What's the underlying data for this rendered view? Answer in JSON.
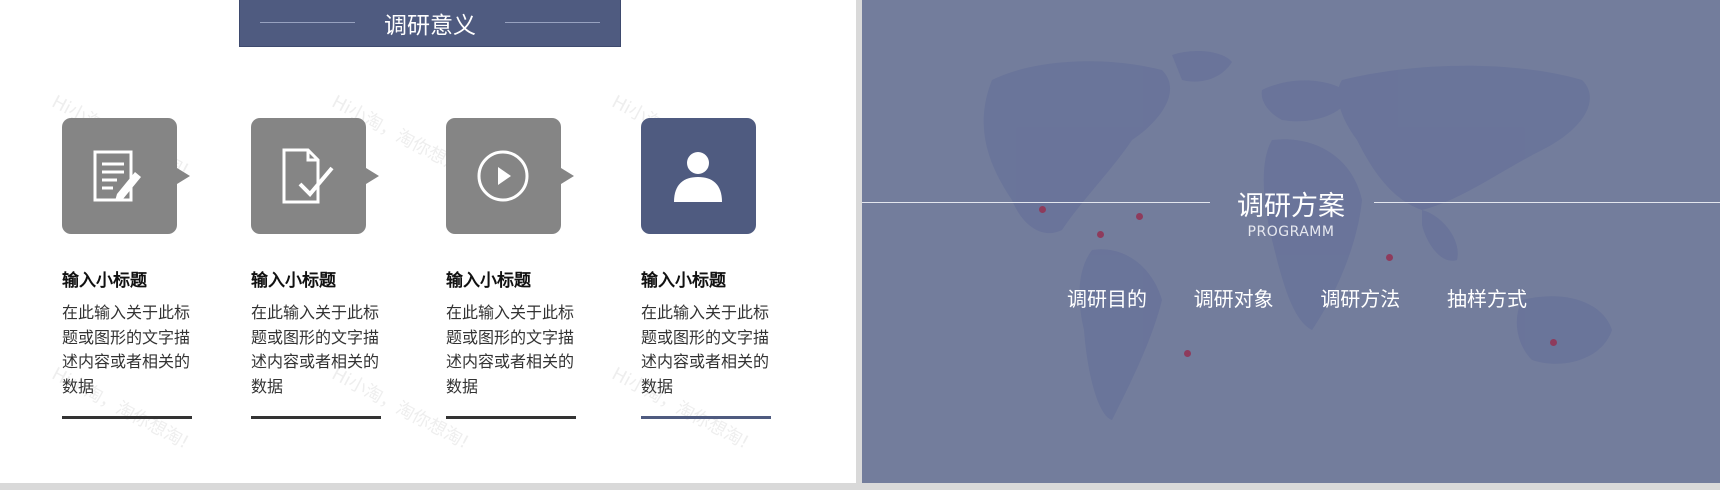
{
  "left_slide": {
    "title": "调研意义",
    "watermark": "Hi小淘，淘你想淘!",
    "cards": [
      {
        "icon": "document-edit-icon",
        "heading": "输入小标题",
        "desc": "在此输入关于此标题或图形的文字描述内容或者相关的数据",
        "highlight": false
      },
      {
        "icon": "document-check-icon",
        "heading": "输入小标题",
        "desc": "在此输入关于此标题或图形的文字描述内容或者相关的数据",
        "highlight": false
      },
      {
        "icon": "play-circle-icon",
        "heading": "输入小标题",
        "desc": "在此输入关于此标题或图形的文字描述内容或者相关的数据",
        "highlight": false
      },
      {
        "icon": "user-icon",
        "heading": "输入小标题",
        "desc": "在此输入关于此标题或图形的文字描述内容或者相关的数据",
        "highlight": true
      }
    ]
  },
  "right_slide": {
    "title": "调研方案",
    "subtitle": "PROGRAMM",
    "items": [
      "调研目的",
      "调研对象",
      "调研方法",
      "抽样方式"
    ]
  },
  "colors": {
    "accent": "#4f5b80",
    "card_gray": "#858585",
    "right_bg": "#737d9c",
    "marker": "#8e3b5c"
  }
}
